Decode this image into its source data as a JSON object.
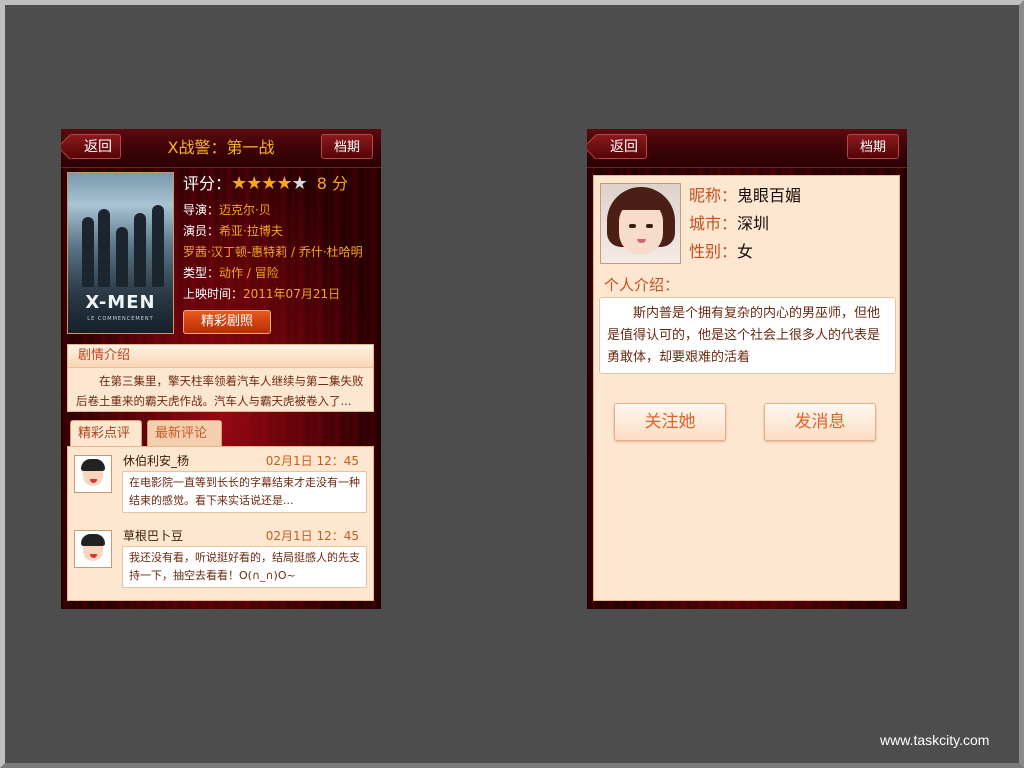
{
  "movie_screen": {
    "back_label": "返回",
    "title": "X战警：第一战",
    "archive_label": "档期",
    "poster": {
      "logo": "X-MEN",
      "subtitle": "LE COMMENCEMENT"
    },
    "rating": {
      "label": "评分：",
      "stars_on": "★★★★",
      "stars_off": "★",
      "stars_filled": 4,
      "stars_total": 5,
      "score_text": "8 分"
    },
    "director": {
      "label": "导演：",
      "value": "迈克尔·贝"
    },
    "cast": {
      "label": "演员：",
      "value": "希亚·拉博夫",
      "line2": "罗茜·汉丁顿-惠特莉 / 乔什·杜哈明"
    },
    "genre": {
      "label": "类型：",
      "value": "动作 / 冒险"
    },
    "release": {
      "label": "上映时间：",
      "value": "2011年07月21日"
    },
    "stills_button": "精彩剧照",
    "synopsis": {
      "title": "剧情介绍",
      "text": "在第三集里，擎天柱率领着汽车人继续与第二集失败后卷土重来的霸天虎作战。汽车人与霸天虎被卷入了..."
    },
    "tabs": [
      {
        "label": "精彩点评"
      },
      {
        "label": "最新评论"
      }
    ],
    "reviews": [
      {
        "name": "休伯利安_杨",
        "time": "02月1日  12：45",
        "text": "在电影院一直等到长长的字幕结束才走没有一种结束的感觉。看下来实话说还是..."
      },
      {
        "name": "草根巴卜豆",
        "time": "02月1日  12：45",
        "text": "我还没有看，听说挺好看的，结局挺感人的先支持一下，抽空去看看！O(∩_∩)O~"
      }
    ]
  },
  "profile_screen": {
    "back_label": "返回",
    "archive_label": "档期",
    "nickname": {
      "label": "昵称：",
      "value": "鬼眼百媚"
    },
    "city": {
      "label": "城市：",
      "value": "深圳"
    },
    "gender": {
      "label": "性别：",
      "value": "女"
    },
    "intro_label": "个人介绍：",
    "intro_text": "斯内普是个拥有复杂的内心的男巫师，但他是值得认可的，他是这个社会上很多人的代表是勇敢体，却要艰难的活着",
    "follow_button": "关注她",
    "message_button": "发消息"
  },
  "watermark": "www.taskcity.com"
}
